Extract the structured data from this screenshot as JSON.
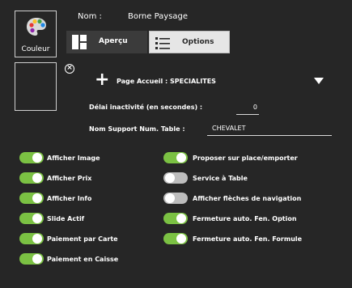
{
  "color_tile": {
    "label": "Couleur",
    "icon": "palette-icon"
  },
  "name": {
    "label": "Nom :",
    "value": "Borne Paysage"
  },
  "tabs": [
    {
      "label": "Aperçu",
      "icon": "layout-icon",
      "active": false
    },
    {
      "label": "Options",
      "icon": "menu-icon",
      "active": true
    }
  ],
  "page_accueil": {
    "text": "Page Accueil : SPECIALITES"
  },
  "delai": {
    "label": "Délai inactivité (en secondes) :",
    "value": "0"
  },
  "support": {
    "label": "Nom Support Num. Table :",
    "value": "CHEVALET"
  },
  "options_left": [
    {
      "label": "Afficher Image",
      "on": true
    },
    {
      "label": "Afficher Prix",
      "on": true
    },
    {
      "label": "Afficher Info",
      "on": true
    },
    {
      "label": "Slide Actif",
      "on": true
    },
    {
      "label": "Paiement par Carte",
      "on": true
    },
    {
      "label": "Paiement en Caisse",
      "on": true
    }
  ],
  "options_right": [
    {
      "label": "Proposer sur place/emporter",
      "on": true
    },
    {
      "label": "Service à Table",
      "on": false
    },
    {
      "label": "Afficher flèches de navigation",
      "on": false
    },
    {
      "label": "Fermeture auto. Fen. Option",
      "on": true
    },
    {
      "label": "Fermeture auto. Fen. Formule",
      "on": true
    }
  ],
  "colors": {
    "background": "#262626",
    "toggle_on": "#7bc143",
    "toggle_off": "#bdbdbd"
  }
}
